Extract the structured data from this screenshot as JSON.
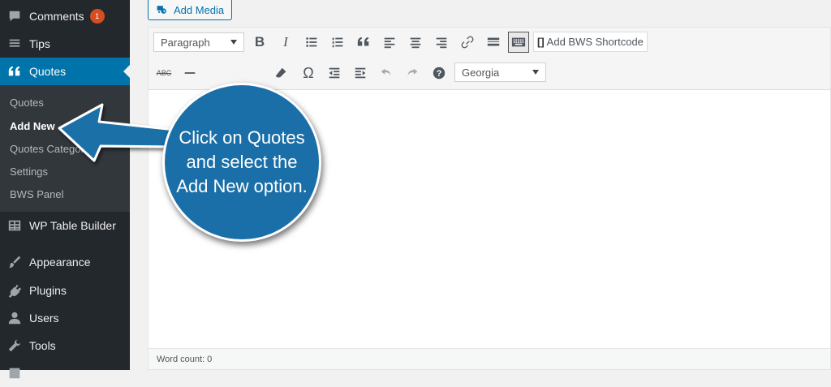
{
  "sidebar": {
    "items": [
      {
        "label": "Comments",
        "badge": "1",
        "icon": "comments-icon"
      },
      {
        "label": "Tips",
        "icon": "tips-icon"
      },
      {
        "label": "Quotes",
        "icon": "quotes-icon"
      },
      {
        "label": "WP Table Builder",
        "icon": "table-icon"
      },
      {
        "label": "Appearance",
        "icon": "paintbrush-icon"
      },
      {
        "label": "Plugins",
        "icon": "plugins-icon"
      },
      {
        "label": "Users",
        "icon": "users-icon"
      },
      {
        "label": "Tools",
        "icon": "wrench-icon"
      }
    ],
    "submenu": [
      "Quotes",
      "Add New",
      "Quotes Categories",
      "Settings",
      "BWS Panel"
    ]
  },
  "editor": {
    "add_media_label": "Add Media",
    "format_select": "Paragraph",
    "font_select": "Georgia",
    "shortcode_label": "Add BWS Shortcode",
    "word_count": "Word count: 0"
  },
  "callout": {
    "text": "Click on Quotes and select the Add New option."
  },
  "colors": {
    "sidebar_bg": "#23282d",
    "active_blue": "#0073aa",
    "callout_blue": "#1b6fa8",
    "badge_orange": "#d54e21"
  }
}
